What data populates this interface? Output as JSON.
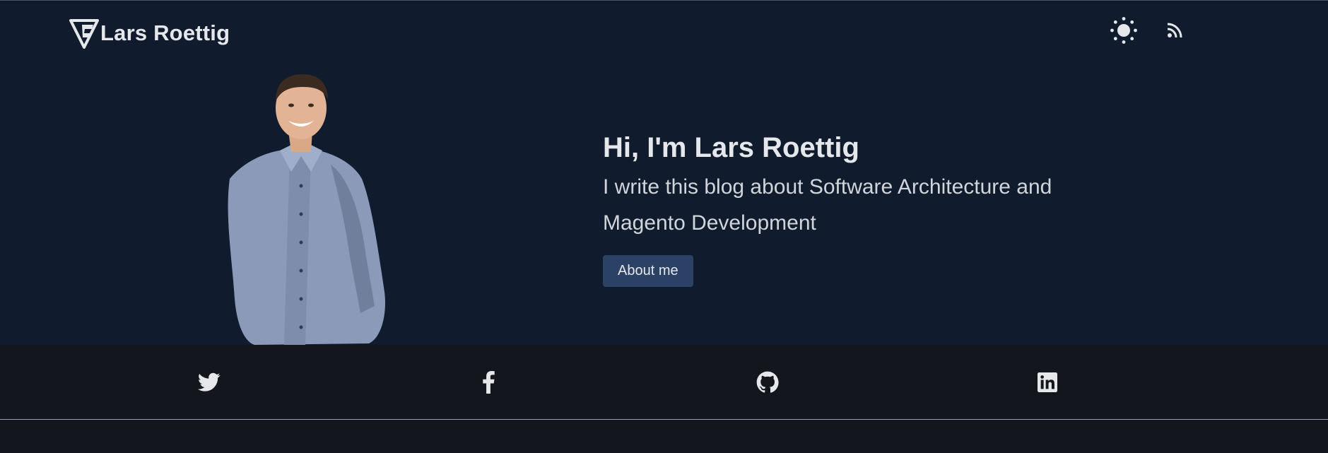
{
  "header": {
    "brand_name": "Lars Roettig",
    "logo_icon": "lr-triangle-logo-icon",
    "theme_toggle_icon": "sun-icon",
    "rss_icon": "rss-icon"
  },
  "hero": {
    "portrait": "portrait-photo",
    "title": "Hi, I'm Lars Roettig",
    "description": "I write this blog about Software Architecture and Magento Development",
    "about_button": "About me"
  },
  "social": {
    "items": [
      {
        "name": "twitter",
        "icon": "twitter-icon"
      },
      {
        "name": "facebook",
        "icon": "facebook-icon"
      },
      {
        "name": "github",
        "icon": "github-icon"
      },
      {
        "name": "linkedin",
        "icon": "linkedin-icon"
      }
    ]
  },
  "colors": {
    "header_bg": "#111b2e",
    "social_bg": "#13171d",
    "accent_button": "#2c4166",
    "text": "#e5e7eb"
  }
}
